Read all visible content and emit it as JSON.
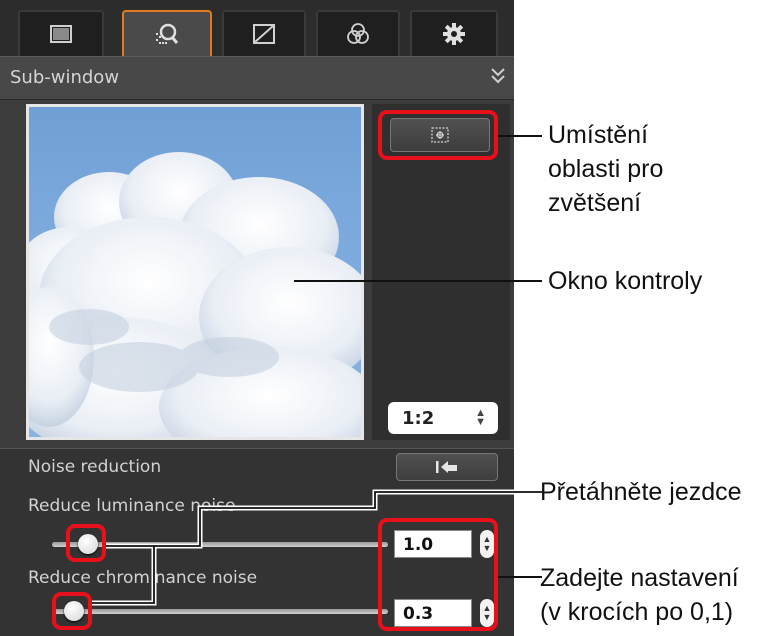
{
  "tabs": [
    {
      "name": "basic-image-adjust",
      "icon": "window-square-icon"
    },
    {
      "name": "detail-view",
      "icon": "magnifier-grid-icon"
    },
    {
      "name": "tone-curve",
      "icon": "curve-icon"
    },
    {
      "name": "color",
      "icon": "color-circles-icon"
    },
    {
      "name": "settings",
      "icon": "gear-icon"
    }
  ],
  "active_tab_index": 1,
  "accent_color": "#e07b1f",
  "highlight_color": "#e8101a",
  "subwindow": {
    "title": "Sub-window",
    "collapse_icon": "double-chevron-down-icon"
  },
  "zoom": {
    "value": "1:2"
  },
  "noise": {
    "section_title": "Noise reduction",
    "reset_icon": "reset-arrow-icon",
    "luminance": {
      "label": "Reduce luminance noise",
      "value": "1.0",
      "slider_fraction": 0.0
    },
    "chrominance": {
      "label": "Reduce chrominance noise",
      "value": "0.3",
      "slider_fraction": 0.0
    }
  },
  "callouts": {
    "placement": "Umístění\noblasti pro\nzvětšení",
    "window": "Okno kontroly",
    "drag": "Přetáhněte jezdce",
    "enter": "Zadejte nastavení\n(v krocích po 0,1)"
  }
}
